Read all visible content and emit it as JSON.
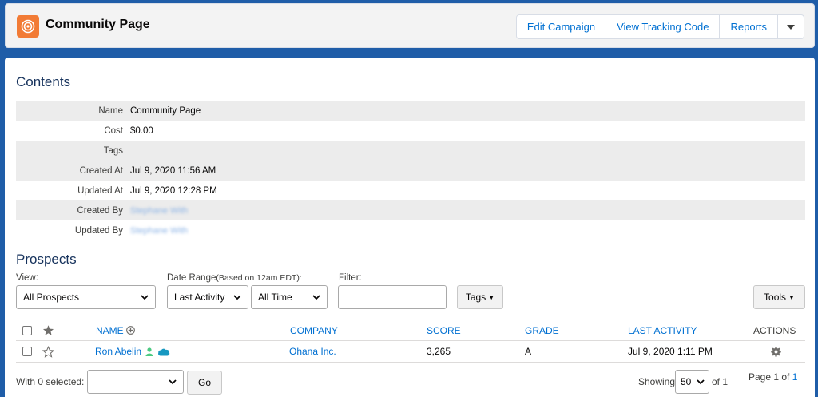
{
  "header": {
    "title": "Community Page",
    "buttons": {
      "edit_campaign": "Edit Campaign",
      "view_tracking_code": "View Tracking Code",
      "reports": "Reports"
    },
    "icon_color": "#f27b35"
  },
  "contents": {
    "heading": "Contents",
    "rows": [
      {
        "label": "Name",
        "value": "Community Page"
      },
      {
        "label": "Cost",
        "value": "$0.00"
      },
      {
        "label": "Tags",
        "value": ""
      },
      {
        "label": "Created At",
        "value": "Jul 9, 2020 11:56 AM"
      },
      {
        "label": "Updated At",
        "value": "Jul 9, 2020 12:28 PM"
      },
      {
        "label": "Created By",
        "value": "Stephane With"
      },
      {
        "label": "Updated By",
        "value": "Stephane With"
      }
    ]
  },
  "prospects": {
    "heading": "Prospects",
    "filters": {
      "view_label": "View:",
      "view_value": "All Prospects",
      "date_range_label": "Date Range",
      "date_range_note": "(Based on 12am EDT):",
      "date_range_activity": "Last Activity",
      "date_range_time": "All Time",
      "filter_label": "Filter:",
      "filter_value": "",
      "tags_button": "Tags",
      "tools_button": "Tools"
    },
    "columns": {
      "name": "NAME",
      "company": "COMPANY",
      "score": "SCORE",
      "grade": "GRADE",
      "last_activity": "LAST ACTIVITY",
      "actions": "ACTIONS"
    },
    "rows": [
      {
        "name": "Ron Abelin",
        "company": "Ohana Inc.",
        "score": "3,265",
        "grade": "A",
        "last_activity": "Jul 9, 2020 1:11 PM"
      }
    ],
    "footer": {
      "with_selected": "With 0 selected:",
      "go_button": "Go",
      "showing": "Showing",
      "page_size": "50",
      "of_total": "of 1",
      "page_text": "Page 1 of",
      "page_link": "1"
    }
  },
  "colors": {
    "link": "#0070d2",
    "background": "#1f5da8",
    "shaded_row": "#ececec"
  }
}
